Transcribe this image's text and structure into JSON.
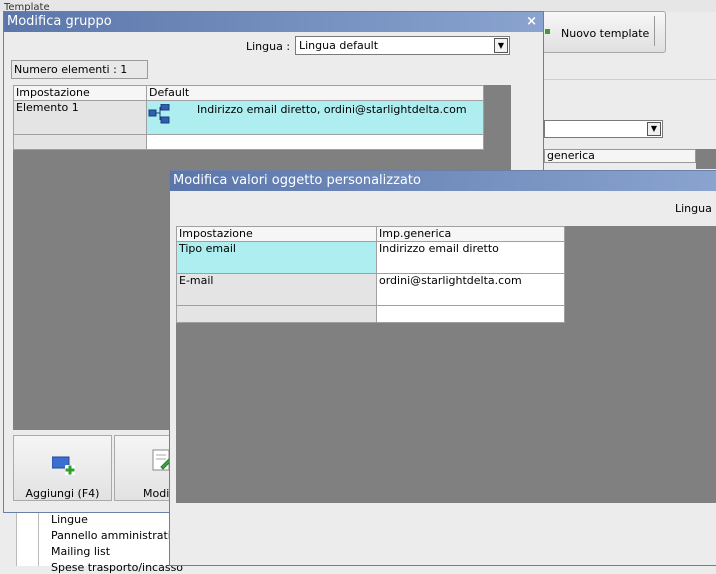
{
  "background": {
    "top_label": "Template",
    "new_template_button": "Nuovo template",
    "column_header": "generica",
    "tree_items": [
      "Lingue",
      "Pannello amministrativo",
      "Mailing list",
      "Spese trasporto/incasso"
    ]
  },
  "group_window": {
    "title": "Modifica gruppo",
    "close": "×",
    "language_label": "Lingua :",
    "language_value": "Lingua default",
    "count_label": "Numero elementi : 1",
    "grid": {
      "headers": [
        "Impostazione",
        "Default"
      ],
      "rows": [
        {
          "setting": "Elemento 1",
          "value": "Indirizzo email diretto, ordini@starlightdelta.com",
          "icon": "custom-object-icon"
        }
      ]
    },
    "buttons": {
      "add": "Aggiungi (F4)",
      "modify": "Modifica"
    }
  },
  "values_window": {
    "title": "Modifica valori oggetto personalizzato",
    "language_label": "Lingua :",
    "grid": {
      "headers": [
        "Impostazione",
        "Imp.generica"
      ],
      "rows": [
        {
          "setting": "Tipo email",
          "value": "Indirizzo email diretto"
        },
        {
          "setting": "E-mail",
          "value": "ordini@starlightdelta.com"
        }
      ]
    }
  },
  "colors": {
    "titlebar_start": "#5b76aa",
    "titlebar_end": "#8aa3cf",
    "selected_cell": "#aeeef0",
    "grid_area": "#808080"
  }
}
